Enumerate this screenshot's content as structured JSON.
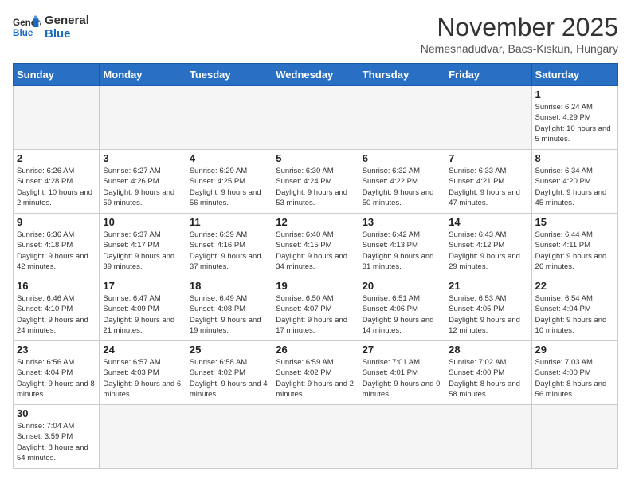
{
  "logo": {
    "line1": "General",
    "line2": "Blue"
  },
  "title": "November 2025",
  "subtitle": "Nemesnadudvar, Bacs-Kiskun, Hungary",
  "weekdays": [
    "Sunday",
    "Monday",
    "Tuesday",
    "Wednesday",
    "Thursday",
    "Friday",
    "Saturday"
  ],
  "days": [
    {
      "date": "",
      "info": ""
    },
    {
      "date": "",
      "info": ""
    },
    {
      "date": "",
      "info": ""
    },
    {
      "date": "",
      "info": ""
    },
    {
      "date": "",
      "info": ""
    },
    {
      "date": "",
      "info": ""
    },
    {
      "date": "1",
      "info": "Sunrise: 6:24 AM\nSunset: 4:29 PM\nDaylight: 10 hours and 5 minutes."
    },
    {
      "date": "2",
      "info": "Sunrise: 6:26 AM\nSunset: 4:28 PM\nDaylight: 10 hours and 2 minutes."
    },
    {
      "date": "3",
      "info": "Sunrise: 6:27 AM\nSunset: 4:26 PM\nDaylight: 9 hours and 59 minutes."
    },
    {
      "date": "4",
      "info": "Sunrise: 6:29 AM\nSunset: 4:25 PM\nDaylight: 9 hours and 56 minutes."
    },
    {
      "date": "5",
      "info": "Sunrise: 6:30 AM\nSunset: 4:24 PM\nDaylight: 9 hours and 53 minutes."
    },
    {
      "date": "6",
      "info": "Sunrise: 6:32 AM\nSunset: 4:22 PM\nDaylight: 9 hours and 50 minutes."
    },
    {
      "date": "7",
      "info": "Sunrise: 6:33 AM\nSunset: 4:21 PM\nDaylight: 9 hours and 47 minutes."
    },
    {
      "date": "8",
      "info": "Sunrise: 6:34 AM\nSunset: 4:20 PM\nDaylight: 9 hours and 45 minutes."
    },
    {
      "date": "9",
      "info": "Sunrise: 6:36 AM\nSunset: 4:18 PM\nDaylight: 9 hours and 42 minutes."
    },
    {
      "date": "10",
      "info": "Sunrise: 6:37 AM\nSunset: 4:17 PM\nDaylight: 9 hours and 39 minutes."
    },
    {
      "date": "11",
      "info": "Sunrise: 6:39 AM\nSunset: 4:16 PM\nDaylight: 9 hours and 37 minutes."
    },
    {
      "date": "12",
      "info": "Sunrise: 6:40 AM\nSunset: 4:15 PM\nDaylight: 9 hours and 34 minutes."
    },
    {
      "date": "13",
      "info": "Sunrise: 6:42 AM\nSunset: 4:13 PM\nDaylight: 9 hours and 31 minutes."
    },
    {
      "date": "14",
      "info": "Sunrise: 6:43 AM\nSunset: 4:12 PM\nDaylight: 9 hours and 29 minutes."
    },
    {
      "date": "15",
      "info": "Sunrise: 6:44 AM\nSunset: 4:11 PM\nDaylight: 9 hours and 26 minutes."
    },
    {
      "date": "16",
      "info": "Sunrise: 6:46 AM\nSunset: 4:10 PM\nDaylight: 9 hours and 24 minutes."
    },
    {
      "date": "17",
      "info": "Sunrise: 6:47 AM\nSunset: 4:09 PM\nDaylight: 9 hours and 21 minutes."
    },
    {
      "date": "18",
      "info": "Sunrise: 6:49 AM\nSunset: 4:08 PM\nDaylight: 9 hours and 19 minutes."
    },
    {
      "date": "19",
      "info": "Sunrise: 6:50 AM\nSunset: 4:07 PM\nDaylight: 9 hours and 17 minutes."
    },
    {
      "date": "20",
      "info": "Sunrise: 6:51 AM\nSunset: 4:06 PM\nDaylight: 9 hours and 14 minutes."
    },
    {
      "date": "21",
      "info": "Sunrise: 6:53 AM\nSunset: 4:05 PM\nDaylight: 9 hours and 12 minutes."
    },
    {
      "date": "22",
      "info": "Sunrise: 6:54 AM\nSunset: 4:04 PM\nDaylight: 9 hours and 10 minutes."
    },
    {
      "date": "23",
      "info": "Sunrise: 6:56 AM\nSunset: 4:04 PM\nDaylight: 9 hours and 8 minutes."
    },
    {
      "date": "24",
      "info": "Sunrise: 6:57 AM\nSunset: 4:03 PM\nDaylight: 9 hours and 6 minutes."
    },
    {
      "date": "25",
      "info": "Sunrise: 6:58 AM\nSunset: 4:02 PM\nDaylight: 9 hours and 4 minutes."
    },
    {
      "date": "26",
      "info": "Sunrise: 6:59 AM\nSunset: 4:02 PM\nDaylight: 9 hours and 2 minutes."
    },
    {
      "date": "27",
      "info": "Sunrise: 7:01 AM\nSunset: 4:01 PM\nDaylight: 9 hours and 0 minutes."
    },
    {
      "date": "28",
      "info": "Sunrise: 7:02 AM\nSunset: 4:00 PM\nDaylight: 8 hours and 58 minutes."
    },
    {
      "date": "29",
      "info": "Sunrise: 7:03 AM\nSunset: 4:00 PM\nDaylight: 8 hours and 56 minutes."
    },
    {
      "date": "30",
      "info": "Sunrise: 7:04 AM\nSunset: 3:59 PM\nDaylight: 8 hours and 54 minutes."
    },
    {
      "date": "",
      "info": ""
    },
    {
      "date": "",
      "info": ""
    },
    {
      "date": "",
      "info": ""
    },
    {
      "date": "",
      "info": ""
    },
    {
      "date": "",
      "info": ""
    },
    {
      "date": "",
      "info": ""
    }
  ]
}
